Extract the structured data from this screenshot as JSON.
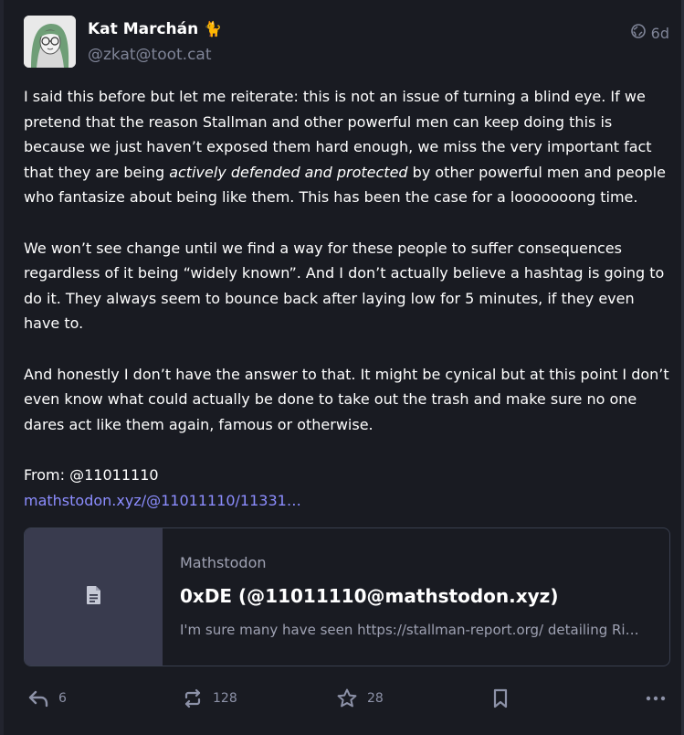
{
  "post": {
    "author": {
      "display_name": "Kat Marchán",
      "emoji": "🐈",
      "handle": "@zkat@toot.cat"
    },
    "visibility_icon": "globe-icon",
    "timestamp": "6d",
    "paragraphs": {
      "p1_before": "I said this before but let me reiterate: this is not an issue of turning a blind eye. If we pretend that the reason Stallman and other powerful men can keep doing this is because we just haven’t exposed them hard enough, we miss the very important fact that they are being ",
      "p1_emphasis": "actively defended and protected",
      "p1_after": " by other powerful men and people who fantasize about being like them. This has been the case for a looooooong time.",
      "p2": "We won’t see change until we find a way for these people to suffer consequences regardless of it being “widely known”. And I don’t actually believe a hashtag is going to do it. They always seem to bounce back after laying low for 5 minutes, if they even have to.",
      "p3": "And honestly I don’t have the answer to that. It might be cynical but at this point I don’t even know what could actually be done to take out the trash and make sure no one dares act like them again, famous or otherwise.",
      "from_label": "From: @11011110",
      "from_link": "mathstodon.xyz/@11011110/11331…"
    },
    "card": {
      "thumb_icon": "document-icon",
      "provider": "Mathstodon",
      "title": "0xDE (@11011110@mathstodon.xyz)",
      "description": "I'm sure many have seen https://stallman-report.org/ detailing Ri…"
    },
    "actions": {
      "reply_count": "6",
      "boost_count": "128",
      "favourite_count": "28"
    }
  },
  "colors": {
    "background": "#191b22",
    "text": "#ffffff",
    "muted": "#7f8497",
    "link": "#8c8dff",
    "card_thumb": "#393b4e"
  }
}
